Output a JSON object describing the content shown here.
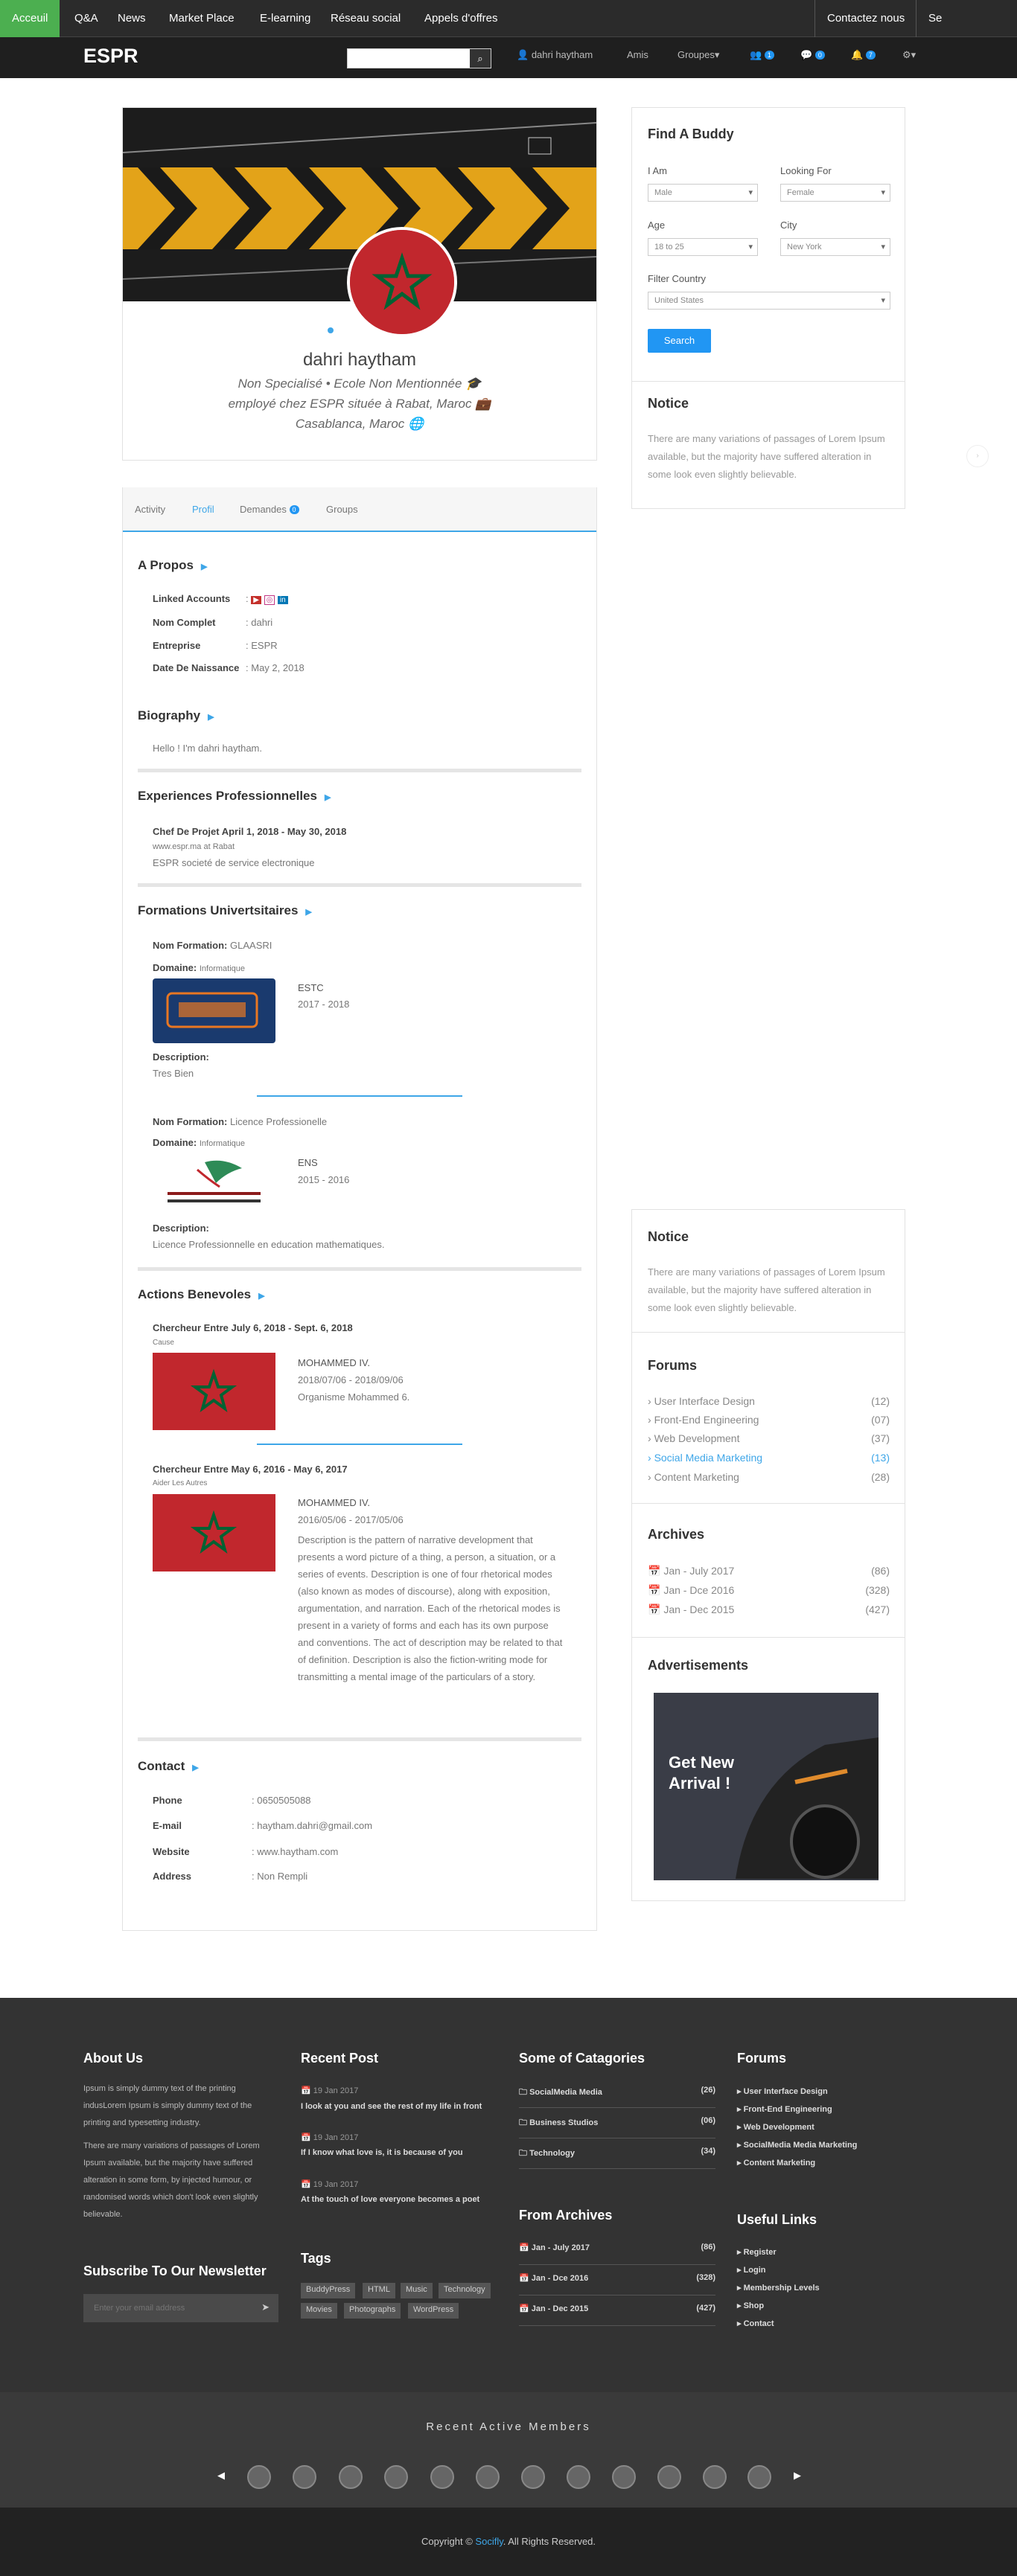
{
  "topnav": {
    "items": [
      "Acceuil",
      "Q&A",
      "News",
      "Market Place",
      "E-learning",
      "Réseau social",
      "Appels d'offres"
    ],
    "right": [
      "Contactez nous",
      "Se deconnecter"
    ]
  },
  "header": {
    "brand": "ESPR",
    "search_placeholder": "",
    "user": "dahri haytham",
    "amis": "Amis",
    "groupes": "Groupes",
    "badges": [
      "1",
      "0",
      "7"
    ]
  },
  "profile": {
    "name": "dahri haytham",
    "line1": "Non Specialisé • Ecole Non Mentionnée",
    "line2": "employé chez ESPR située à Rabat, Maroc",
    "line3": "Casablanca, Maroc"
  },
  "tabs": {
    "activity": "Activity",
    "profil": "Profil",
    "demandes": "Demandes",
    "demandes_count": "0",
    "groups": "Groups"
  },
  "apropos": {
    "title": "A Propos",
    "rows": [
      {
        "label": "Linked Accounts",
        "value": ""
      },
      {
        "label": "Nom Complet",
        "value": "dahri"
      },
      {
        "label": "Entreprise",
        "value": "ESPR"
      },
      {
        "label": "Date De Naissance",
        "value": "May 2, 2018"
      }
    ]
  },
  "biography": {
    "title": "Biography",
    "text": "Hello ! I'm dahri haytham."
  },
  "experiences": {
    "title": "Experiences Professionnelles",
    "role": "Chef De Projet April 1, 2018 - May 30, 2018",
    "site": "www.espr.ma at Rabat",
    "desc": "ESPR societé de service electronique"
  },
  "formations": {
    "title": "Formations Univertsitaires",
    "items": [
      {
        "nom_label": "Nom Formation:",
        "nom": "GLAASRI",
        "domaine_label": "Domaine:",
        "domaine": "Informatique",
        "school": "ESTC",
        "years": "2017 - 2018",
        "desc_label": "Description:",
        "desc": "Tres Bien"
      },
      {
        "nom_label": "Nom Formation:",
        "nom": "Licence Professionelle",
        "domaine_label": "Domaine:",
        "domaine": "Informatique",
        "school": "ENS",
        "years": "2015 - 2016",
        "desc_label": "Description:",
        "desc": "Licence Professionnelle en education mathematiques."
      }
    ]
  },
  "benevoles": {
    "title": "Actions Benevoles",
    "items": [
      {
        "head": "Chercheur Entre July 6, 2018 - Sept. 6, 2018",
        "sub": "Cause",
        "org": "MOHAMMED IV.",
        "dates": "2018/07/06 - 2018/09/06",
        "desc": "Organisme Mohammed 6."
      },
      {
        "head": "Chercheur Entre May 6, 2016 - May 6, 2017",
        "sub": "Aider Les Autres",
        "org": "MOHAMMED IV.",
        "dates": "2016/05/06 - 2017/05/06",
        "desc": "Description is the pattern of narrative development that presents a word picture of a thing, a person, a situation, or a series of events. Description is one of four rhetorical modes (also known as modes of discourse), along with exposition, argumentation, and narration. Each of the rhetorical modes is present in a variety of forms and each has its own purpose and conventions. The act of description may be related to that of definition. Description is also the fiction-writing mode for transmitting a mental image of the particulars of a story."
      }
    ]
  },
  "contact": {
    "title": "Contact",
    "rows": [
      {
        "label": "Phone",
        "value": "0650505088"
      },
      {
        "label": "E-mail",
        "value": "haytham.dahri@gmail.com"
      },
      {
        "label": "Website",
        "value": "www.haytham.com"
      },
      {
        "label": "Address",
        "value": "Non Rempli"
      }
    ]
  },
  "buddy": {
    "title": "Find A Buddy",
    "i_am": "I Am",
    "i_am_val": "Male",
    "looking": "Looking For",
    "looking_val": "Female",
    "age": "Age",
    "age_val": "18 to 25",
    "city": "City",
    "city_val": "New York",
    "country": "Filter Country",
    "country_val": "United States",
    "search": "Search"
  },
  "notice": {
    "title": "Notice",
    "text": "There are many variations of passages of Lorem Ipsum available, but the majority have suffered alteration in some look even slightly believable."
  },
  "forums": {
    "title": "Forums",
    "items": [
      {
        "name": "User Interface Design",
        "count": "(12)"
      },
      {
        "name": "Front-End Engineering",
        "count": "(07)"
      },
      {
        "name": "Web Development",
        "count": "(37)"
      },
      {
        "name": "Social Media Marketing",
        "count": "(13)"
      },
      {
        "name": "Content Marketing",
        "count": "(28)"
      }
    ]
  },
  "archives": {
    "title": "Archives",
    "items": [
      {
        "name": "Jan - July 2017",
        "count": "(86)"
      },
      {
        "name": "Jan - Dce 2016",
        "count": "(328)"
      },
      {
        "name": "Jan - Dec 2015",
        "count": "(427)"
      }
    ]
  },
  "ads": {
    "title": "Advertisements",
    "text": "Get New Arrival !"
  },
  "footer": {
    "about_title": "About Us",
    "about1": "Ipsum is simply dummy text of the printing indusLorem Ipsum is simply dummy text of the printing and typesetting industry.",
    "about2": "There are many variations of passages of Lorem Ipsum available, but the majority have suffered alteration in some form, by injected humour, or randomised words which don't look even slightly believable.",
    "newsletter_title": "Subscribe To Our Newsletter",
    "newsletter_placeholder": "Enter your email address",
    "recent_title": "Recent Post",
    "posts": [
      {
        "date": "19 Jan 2017",
        "title": "I look at you and see the rest of my life in front"
      },
      {
        "date": "19 Jan 2017",
        "title": "If I know what love is, it is because of you"
      },
      {
        "date": "19 Jan 2017",
        "title": "At the touch of love everyone becomes a poet"
      }
    ],
    "tags_title": "Tags",
    "tags": [
      "BuddyPress",
      "HTML",
      "Music",
      "Technology",
      "Movies",
      "Photographs",
      "WordPress"
    ],
    "cat_title": "Some of Catagories",
    "cats": [
      {
        "name": "SocialMedia Media",
        "count": "(26)"
      },
      {
        "name": "Business Studios",
        "count": "(06)"
      },
      {
        "name": "Technology",
        "count": "(34)"
      }
    ],
    "arch_title": "From Archives",
    "arch": [
      {
        "name": "Jan - July 2017",
        "count": "(86)"
      },
      {
        "name": "Jan - Dce 2016",
        "count": "(328)"
      },
      {
        "name": "Jan - Dec 2015",
        "count": "(427)"
      }
    ],
    "forums_title": "Forums",
    "forums": [
      "User Interface Design",
      "Front-End Engineering",
      "Web Development",
      "SocialMedia Media Marketing",
      "Content Marketing"
    ],
    "links_title": "Useful Links",
    "links": [
      "Register",
      "Login",
      "Membership Levels",
      "Shop",
      "Contact"
    ],
    "members_title": "Recent Active Members",
    "copyright_pre": "Copyright © ",
    "copyright_brand": "Socifly",
    "copyright_post": ". All Rights Reserved."
  },
  "colors": {
    "accent": "#3ea6e8",
    "green": "#4caf50",
    "badge": "#2196f3"
  }
}
